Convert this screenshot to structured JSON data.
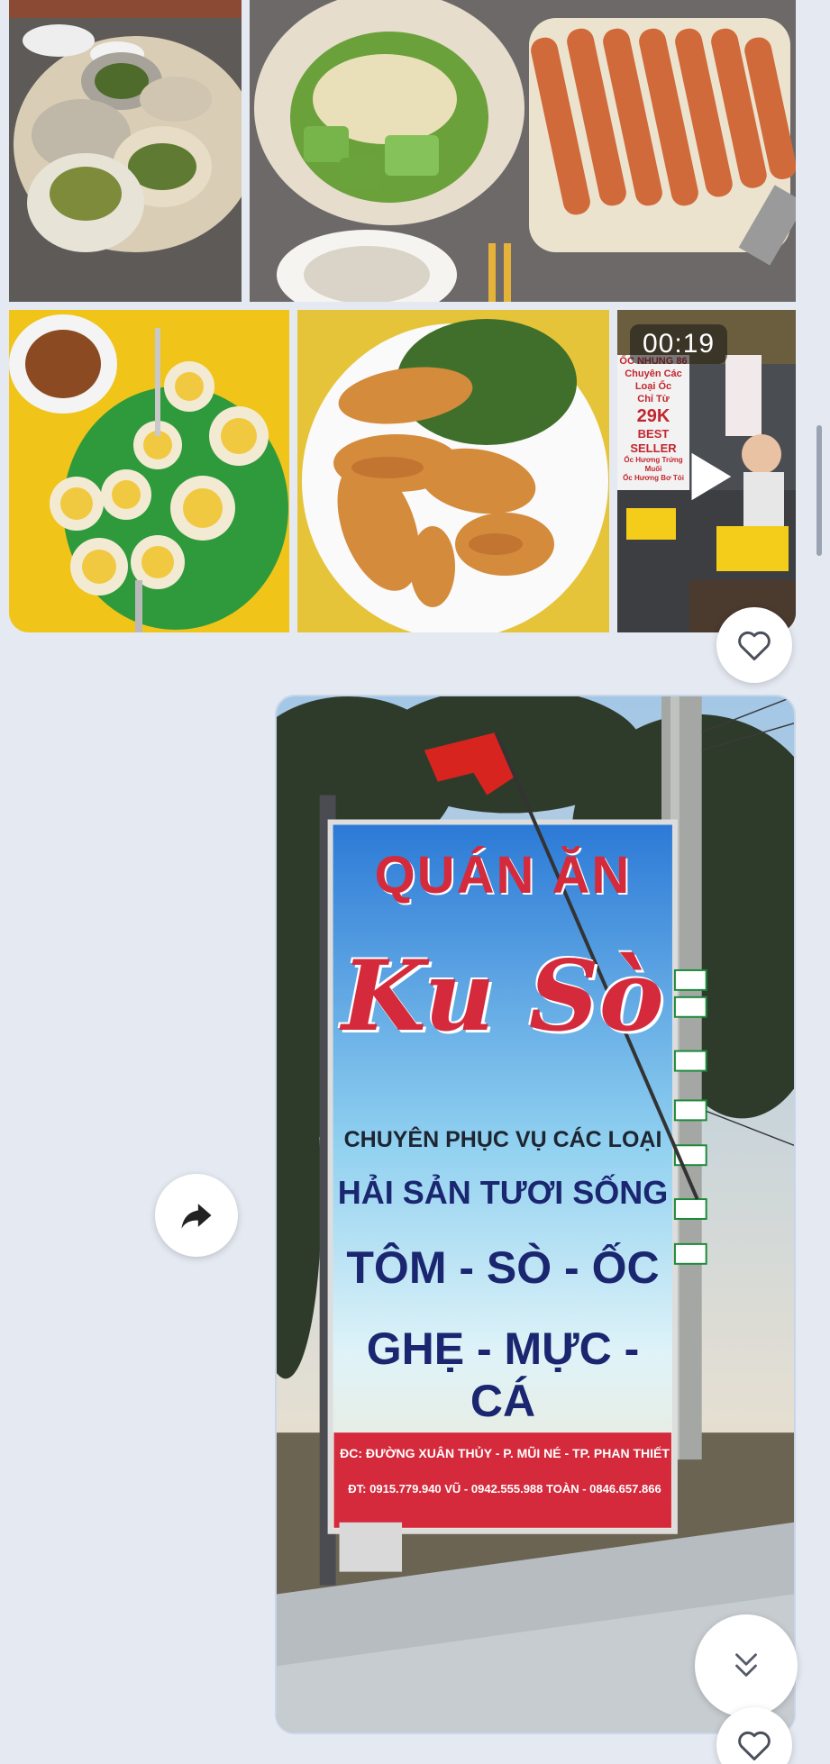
{
  "album": {
    "video_duration": "00:19",
    "video_sign_lines": [
      "ỐC NHUNG 86",
      "Chuyên Các",
      "Loại Ốc",
      "Chỉ Từ",
      "29K",
      "BEST SELLER",
      "Ốc Hương Trứng Muối",
      "Ốc Hương Bơ Tỏi"
    ]
  },
  "sign": {
    "line1": "QUÁN ĂN",
    "line2": "Ku Sò",
    "line3": "CHUYÊN PHỤC VỤ CÁC LOẠI",
    "line4": "HẢI SẢN TƯƠI SỐNG",
    "line5": "TÔM - SÒ - ỐC",
    "line6": "GHẸ - MỰC - CÁ",
    "address": "ĐC: ĐƯỜNG XUÂN THỦY - P. MŨI NÉ - TP. PHAN THIẾT",
    "phones": "ĐT: 0915.779.940 VŨ - 0942.555.988 TOÀN - 0846.657.866"
  },
  "icons": {
    "like": "heart-outline-icon",
    "share": "share-arrow-icon",
    "scroll_down": "double-chevron-down-icon",
    "play": "play-icon"
  },
  "colors": {
    "background": "#e5e9f2",
    "sign_red": "#d42a3c",
    "sign_navy": "#1b2670"
  }
}
